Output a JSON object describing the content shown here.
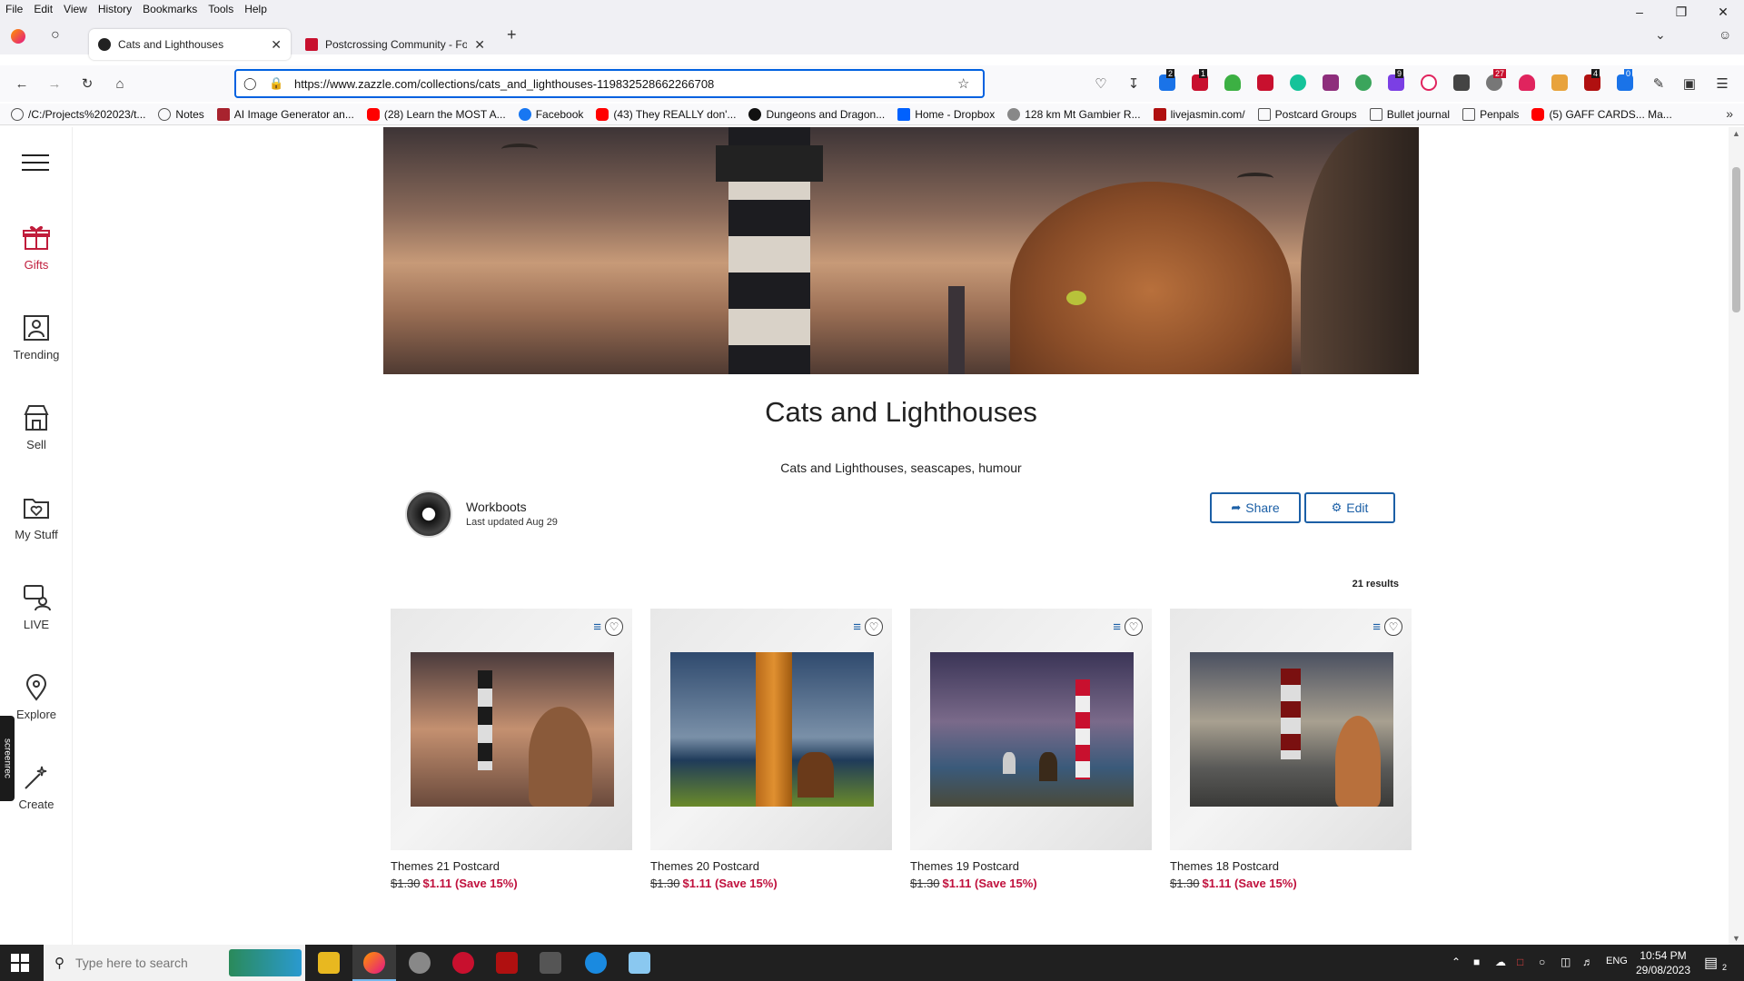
{
  "menubar": {
    "items": [
      "File",
      "Edit",
      "View",
      "History",
      "Bookmarks",
      "Tools",
      "Help"
    ]
  },
  "tabs": [
    {
      "label": "Cats and Lighthouses"
    },
    {
      "label": "Postcrossing Community - Foru"
    }
  ],
  "navbar": {
    "url": "https://www.zazzle.com/collections/cats_and_lighthouses-119832528662266708"
  },
  "extensions": {
    "badges": [
      "2",
      "1",
      "9",
      "27",
      "4",
      "0"
    ]
  },
  "bookmarks": [
    {
      "label": "/C:/Projects%202023/t...",
      "icon": "globe-icon",
      "color": "#555555"
    },
    {
      "label": "Notes",
      "icon": "globe-icon",
      "color": "#555555"
    },
    {
      "label": "AI Image Generator an...",
      "icon": "ai-icon",
      "color": "#a8232e"
    },
    {
      "label": "(28) Learn the MOST A...",
      "icon": "youtube-icon",
      "color": "#ff0000"
    },
    {
      "label": "Facebook",
      "icon": "facebook-icon",
      "color": "#1877f2"
    },
    {
      "label": "(43) They REALLY don'...",
      "icon": "youtube-icon",
      "color": "#ff0000"
    },
    {
      "label": "Dungeons and Dragon...",
      "icon": "dnd-icon",
      "color": "#111111"
    },
    {
      "label": "Home - Dropbox",
      "icon": "dropbox-icon",
      "color": "#0061fe"
    },
    {
      "label": "128 km Mt Gambier R...",
      "icon": "globe-icon",
      "color": "#888888"
    },
    {
      "label": "livejasmin.com/",
      "icon": "lj-icon",
      "color": "#b01010"
    },
    {
      "label": "Postcard Groups",
      "icon": "folder-icon",
      "color": "#555555"
    },
    {
      "label": "Bullet journal",
      "icon": "folder-icon",
      "color": "#555555"
    },
    {
      "label": "Penpals",
      "icon": "folder-icon",
      "color": "#555555"
    },
    {
      "label": "(5) GAFF CARDS... Ma...",
      "icon": "youtube-icon",
      "color": "#ff0000"
    }
  ],
  "leftnav": [
    {
      "label": "Gifts",
      "icon": "gift-icon",
      "active": true
    },
    {
      "label": "Trending",
      "icon": "trending-icon",
      "active": false
    },
    {
      "label": "Sell",
      "icon": "store-icon",
      "active": false
    },
    {
      "label": "My Stuff",
      "icon": "folder-heart-icon",
      "active": false
    },
    {
      "label": "LIVE",
      "icon": "live-chat-icon",
      "active": false
    },
    {
      "label": "Explore",
      "icon": "explore-pin-icon",
      "active": false
    },
    {
      "label": "Create",
      "icon": "magic-wand-icon",
      "active": false
    }
  ],
  "screenrec_label": "screenrec",
  "collection": {
    "title": "Cats and Lighthouses",
    "description": "Cats and Lighthouses, seascapes, humour",
    "author": "Workboots",
    "updated": "Last updated Aug 29",
    "share_label": "Share",
    "edit_label": "Edit",
    "results": "21 results"
  },
  "products": [
    {
      "name": "Themes 21 Postcard",
      "old_price": "$1.30",
      "price": "$1.11",
      "save": "(Save 15%)"
    },
    {
      "name": "Themes 20 Postcard",
      "old_price": "$1.30",
      "price": "$1.11",
      "save": "(Save 15%)"
    },
    {
      "name": "Themes 19 Postcard",
      "old_price": "$1.30",
      "price": "$1.11",
      "save": "(Save 15%)"
    },
    {
      "name": "Themes 18 Postcard",
      "old_price": "$1.30",
      "price": "$1.11",
      "save": "(Save 15%)"
    }
  ],
  "taskbar": {
    "search_placeholder": "Type here to search",
    "language": "ENG",
    "time": "10:54 PM",
    "date": "29/08/2023",
    "notification_count": "2"
  },
  "colors": {
    "accent_blue": "#1b5fa6",
    "sale_red": "#c0113d",
    "nav_active": "#c01c3b"
  }
}
